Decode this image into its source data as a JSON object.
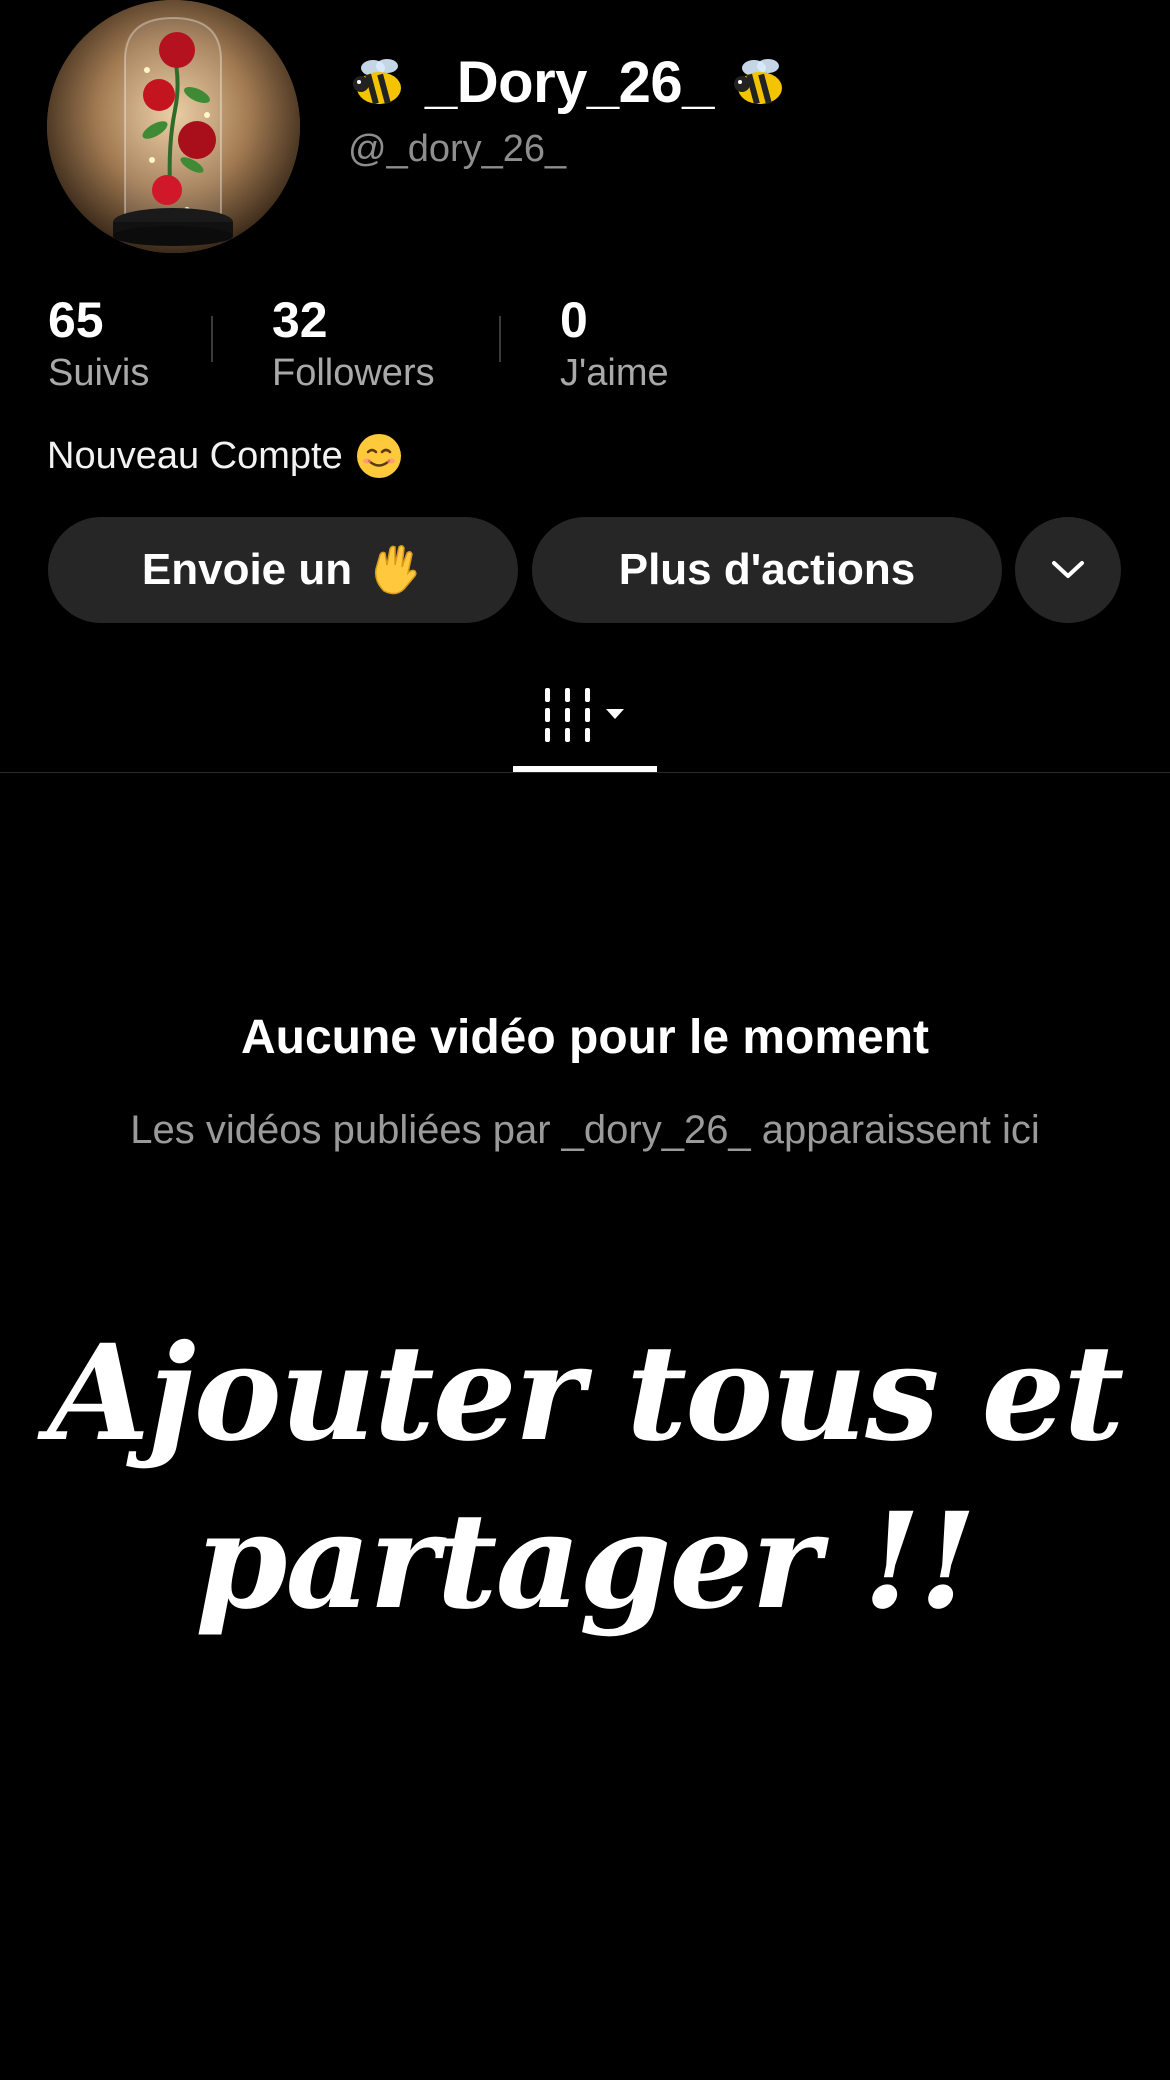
{
  "profile": {
    "display_name": "_Dory_26_",
    "handle": "@_dory_26_",
    "bio": "Nouveau Compte",
    "avatar_icon": "rose-in-glass-dome"
  },
  "stats": [
    {
      "value": "65",
      "label": "Suivis"
    },
    {
      "value": "32",
      "label": "Followers"
    },
    {
      "value": "0",
      "label": "J'aime"
    }
  ],
  "actions": {
    "wave_label": "Envoie un",
    "more_label": "Plus d'actions",
    "dropdown_icon": "chevron-down-icon"
  },
  "tabs": {
    "videos_icon": "video-grid-icon"
  },
  "empty_state": {
    "title": "Aucune vidéo pour le moment",
    "subtitle": "Les vidéos publiées par _dory_26_ apparaissent ici"
  },
  "overlay_caption": {
    "line1": "Ajouter tous et",
    "line2": "partager !!"
  },
  "colors": {
    "background": "#000000",
    "button_bg": "#262626",
    "secondary_text": "#8e8e8e"
  }
}
